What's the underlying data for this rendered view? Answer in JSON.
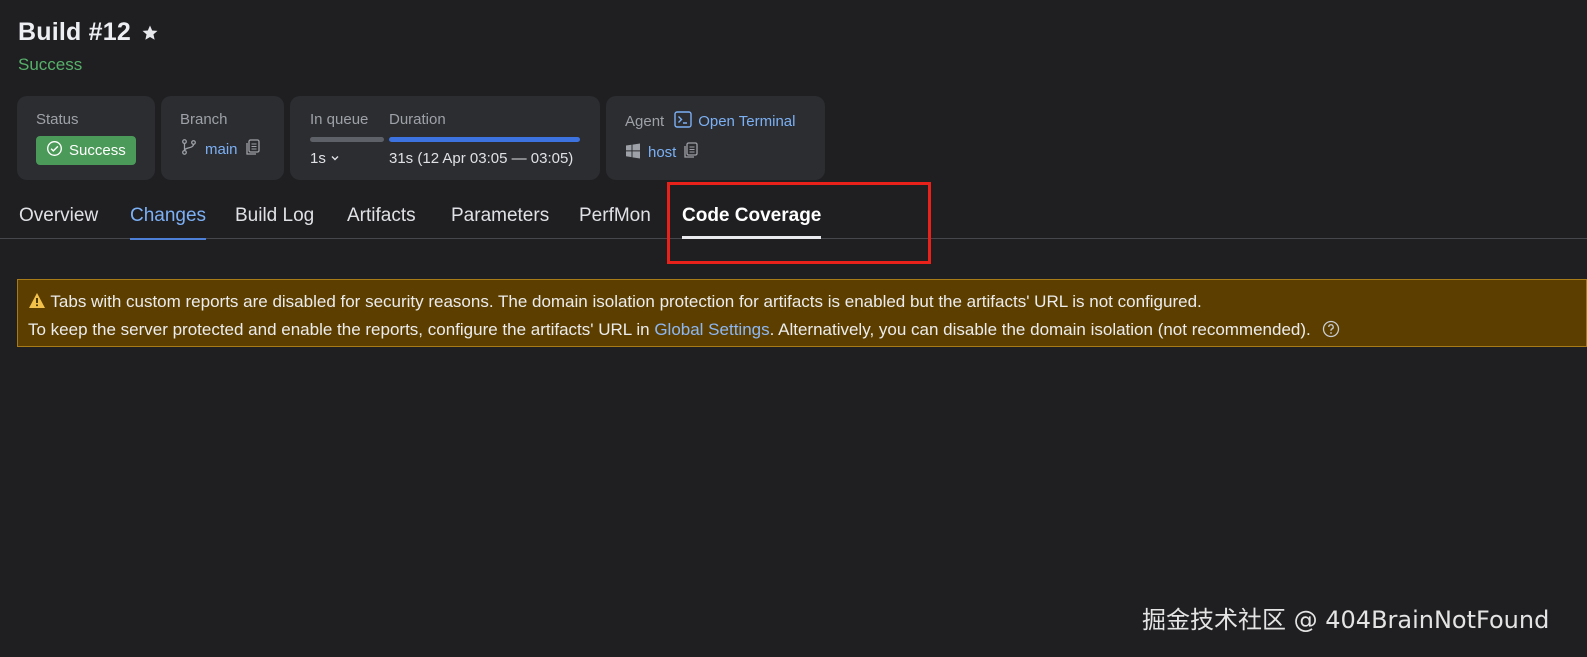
{
  "header": {
    "title": "Build #12",
    "subtitle": "Success"
  },
  "cards": {
    "status": {
      "label": "Status",
      "badge": "Success"
    },
    "branch": {
      "label": "Branch",
      "value": "main"
    },
    "queue": {
      "label": "In queue",
      "value": "1s",
      "progress": 1.0
    },
    "duration": {
      "label": "Duration",
      "value": "31s (12 Apr 03:05 — 03:05)",
      "progress": 1.0
    },
    "agent": {
      "label": "Agent",
      "terminal_link": "Open Terminal",
      "value": "host"
    }
  },
  "tabs": [
    {
      "label": "Overview"
    },
    {
      "label": "Changes"
    },
    {
      "label": "Build Log"
    },
    {
      "label": "Artifacts"
    },
    {
      "label": "Parameters"
    },
    {
      "label": "PerfMon"
    },
    {
      "label": "Code Coverage"
    }
  ],
  "warning": {
    "line1": "Tabs with custom reports are disabled for security reasons. The domain isolation protection for artifacts is enabled but the artifacts' URL is not configured.",
    "line2_pre": "To keep the server protected and enable the reports, configure the artifacts' URL in ",
    "line2_link": "Global Settings",
    "line2_post": ". Alternatively, you can disable the domain isolation (not recommended)."
  },
  "watermark": "掘金技术社区 @ 404BrainNotFound",
  "colors": {
    "background": "#1f1f22",
    "card": "#2b2d30",
    "success": "#4c9a59",
    "link": "#7cb0f5",
    "warning_bg": "#5c3f00",
    "highlight": "#e8211b"
  }
}
